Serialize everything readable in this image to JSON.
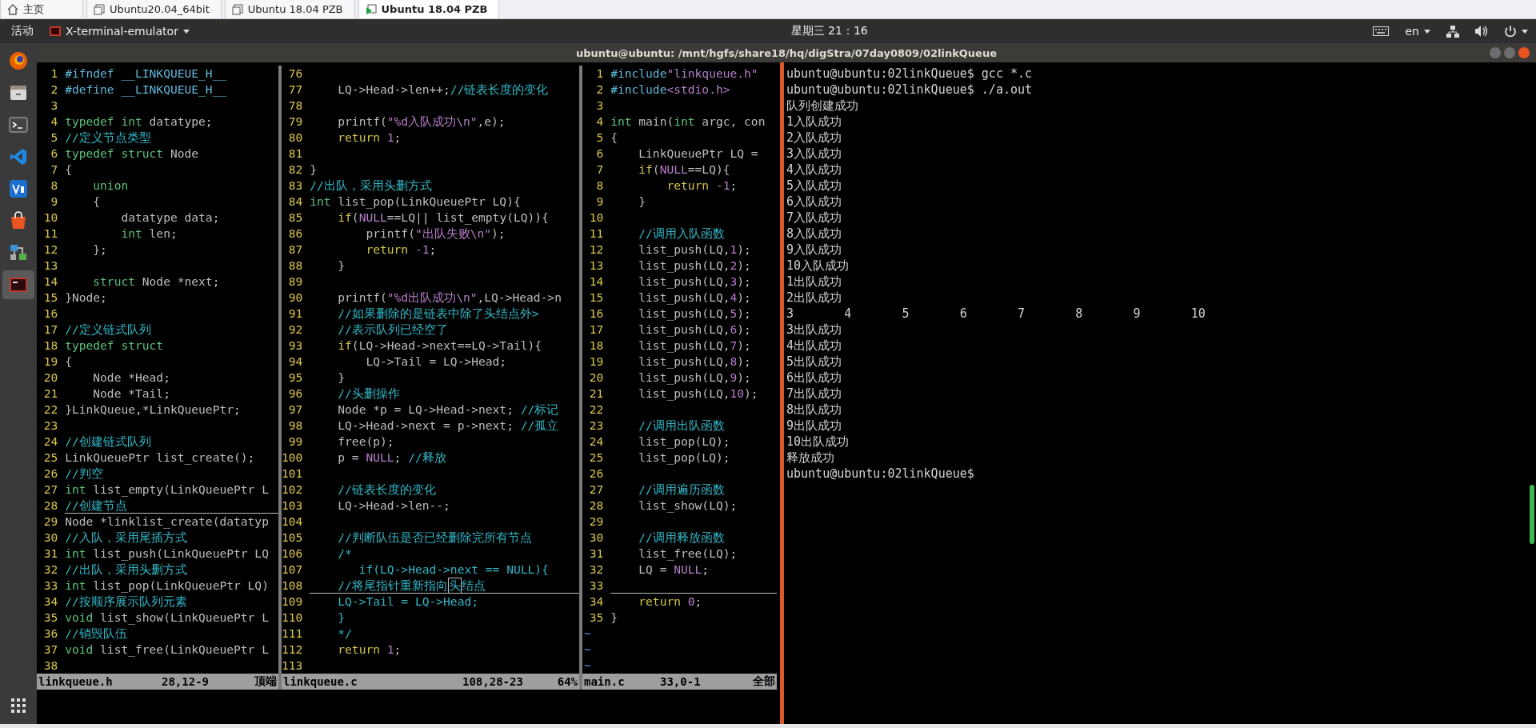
{
  "vm_tabs": [
    {
      "label": "主页",
      "kind": "home",
      "selected": false
    },
    {
      "label": "Ubuntu20.04_64bit",
      "kind": "vm",
      "selected": false
    },
    {
      "label": "Ubuntu 18.04 PZB",
      "kind": "vm",
      "selected": false
    },
    {
      "label": "Ubuntu 18.04 PZB",
      "kind": "vm",
      "selected": true
    }
  ],
  "top_bar": {
    "activities": "活动",
    "app_menu": "X-terminal-emulator",
    "clock": "星期三 21：16",
    "language": "en"
  },
  "window": {
    "title": "ubuntu@ubuntu: /mnt/hgfs/share18/hq/digStra/07day0809/02linkQueue"
  },
  "dock": {
    "items": [
      {
        "kind": "browser",
        "selected": false
      },
      {
        "kind": "files",
        "selected": false
      },
      {
        "kind": "terminal",
        "selected": false
      },
      {
        "kind": "editor",
        "selected": false
      },
      {
        "kind": "app",
        "selected": false
      },
      {
        "kind": "store",
        "selected": false
      },
      {
        "kind": "network",
        "selected": false
      },
      {
        "kind": "xterm",
        "selected": true
      }
    ]
  },
  "vim": {
    "panes": [
      {
        "file": "linkqueue.h",
        "position": "28,12-9",
        "scroll": "顶端",
        "lines": [
          {
            "num": "1",
            "current": false,
            "segs": [
              {
                "kind": "pre",
                "text": "#ifndef __LINKQUEUE_H__"
              }
            ]
          },
          {
            "num": "2",
            "current": false,
            "segs": [
              {
                "kind": "pre",
                "text": "#define __LINKQUEUE_H__"
              }
            ]
          },
          {
            "num": "3",
            "current": false
          },
          {
            "num": "4",
            "current": false,
            "segs": [
              {
                "kind": "type",
                "text": "typedef int"
              },
              {
                "kind": "plain",
                "text": " datatype;"
              }
            ]
          },
          {
            "num": "5",
            "current": false,
            "segs": [
              {
                "kind": "comment",
                "text": "//定义节点类型"
              }
            ]
          },
          {
            "num": "6",
            "current": false,
            "segs": [
              {
                "kind": "type",
                "text": "typedef struct"
              },
              {
                "kind": "plain",
                "text": " Node"
              }
            ]
          },
          {
            "num": "7",
            "current": false,
            "segs": [
              {
                "kind": "plain",
                "text": "{"
              }
            ]
          },
          {
            "num": "8",
            "current": false,
            "segs": [
              {
                "kind": "type",
                "text": "    union"
              }
            ]
          },
          {
            "num": "9",
            "current": false,
            "segs": [
              {
                "kind": "plain",
                "text": "    {"
              }
            ]
          },
          {
            "num": "10",
            "current": false,
            "segs": [
              {
                "kind": "plain",
                "text": "        datatype data;"
              }
            ]
          },
          {
            "num": "11",
            "current": false,
            "segs": [
              {
                "kind": "type",
                "text": "        int"
              },
              {
                "kind": "plain",
                "text": " len;"
              }
            ]
          },
          {
            "num": "12",
            "current": false,
            "segs": [
              {
                "kind": "plain",
                "text": "    };"
              }
            ]
          },
          {
            "num": "13",
            "current": false
          },
          {
            "num": "14",
            "current": false,
            "segs": [
              {
                "kind": "type",
                "text": "    struct"
              },
              {
                "kind": "plain",
                "text": " Node *next;"
              }
            ]
          },
          {
            "num": "15",
            "current": false,
            "segs": [
              {
                "kind": "plain",
                "text": "}Node;"
              }
            ]
          },
          {
            "num": "16",
            "current": false
          },
          {
            "num": "17",
            "current": false,
            "segs": [
              {
                "kind": "comment",
                "text": "//定义链式队列"
              }
            ]
          },
          {
            "num": "18",
            "current": false,
            "segs": [
              {
                "kind": "type",
                "text": "typedef struct"
              }
            ]
          },
          {
            "num": "19",
            "current": false,
            "segs": [
              {
                "kind": "plain",
                "text": "{"
              }
            ]
          },
          {
            "num": "20",
            "current": false,
            "segs": [
              {
                "kind": "plain",
                "text": "    Node *Head;"
              }
            ]
          },
          {
            "num": "21",
            "current": false,
            "segs": [
              {
                "kind": "plain",
                "text": "    Node *Tail;"
              }
            ]
          },
          {
            "num": "22",
            "current": false,
            "segs": [
              {
                "kind": "plain",
                "text": "}LinkQueue,*LinkQueuePtr;"
              }
            ]
          },
          {
            "num": "23",
            "current": false
          },
          {
            "num": "24",
            "current": false,
            "segs": [
              {
                "kind": "comment",
                "text": "//创建链式队列"
              }
            ]
          },
          {
            "num": "25",
            "current": false,
            "segs": [
              {
                "kind": "plain",
                "text": "LinkQueuePtr list_create();"
              }
            ]
          },
          {
            "num": "26",
            "current": false,
            "segs": [
              {
                "kind": "comment",
                "text": "//判空"
              }
            ]
          },
          {
            "num": "27",
            "current": false,
            "segs": [
              {
                "kind": "type",
                "text": "int"
              },
              {
                "kind": "plain",
                "text": " list_empty(LinkQueuePtr L"
              }
            ]
          },
          {
            "num": "28",
            "current": true,
            "segs": [
              {
                "kind": "comment",
                "text": "//创建节点"
              }
            ]
          },
          {
            "num": "29",
            "current": false,
            "segs": [
              {
                "kind": "plain",
                "text": "Node *linklist_create(datatyp"
              }
            ]
          },
          {
            "num": "30",
            "current": false,
            "segs": [
              {
                "kind": "comment",
                "text": "//入队，采用尾插方式"
              }
            ]
          },
          {
            "num": "31",
            "current": false,
            "segs": [
              {
                "kind": "type",
                "text": "int"
              },
              {
                "kind": "plain",
                "text": " list_push(LinkQueuePtr LQ"
              }
            ]
          },
          {
            "num": "32",
            "current": false,
            "segs": [
              {
                "kind": "comment",
                "text": "//出队，采用头删方式"
              }
            ]
          },
          {
            "num": "33",
            "current": false,
            "segs": [
              {
                "kind": "type",
                "text": "int"
              },
              {
                "kind": "plain",
                "text": " list_pop(LinkQueuePtr LQ)"
              }
            ]
          },
          {
            "num": "34",
            "current": false,
            "segs": [
              {
                "kind": "comment",
                "text": "//按顺序展示队列元素"
              }
            ]
          },
          {
            "num": "35",
            "current": false,
            "segs": [
              {
                "kind": "type",
                "text": "void"
              },
              {
                "kind": "plain",
                "text": " list_show(LinkQueuePtr L"
              }
            ]
          },
          {
            "num": "36",
            "current": false,
            "segs": [
              {
                "kind": "comment",
                "text": "//销毁队伍"
              }
            ]
          },
          {
            "num": "37",
            "current": false,
            "segs": [
              {
                "kind": "type",
                "text": "void"
              },
              {
                "kind": "plain",
                "text": " list_free(LinkQueuePtr L"
              }
            ]
          },
          {
            "num": "38",
            "current": false
          }
        ]
      },
      {
        "file": "linkqueue.c",
        "position": "108,28-23",
        "scroll": "64%",
        "lines": [
          {
            "num": "76",
            "current": false
          },
          {
            "num": "77",
            "current": false,
            "segs": [
              {
                "kind": "plain",
                "text": "    LQ->Head->len++;"
              },
              {
                "kind": "comment",
                "text": "//链表长度的变化"
              }
            ]
          },
          {
            "num": "78",
            "current": false
          },
          {
            "num": "79",
            "current": false,
            "segs": [
              {
                "kind": "plain",
                "text": "    printf("
              },
              {
                "kind": "const",
                "text": "\"%d入队成功\\n\""
              },
              {
                "kind": "plain",
                "text": ",e);"
              }
            ]
          },
          {
            "num": "80",
            "current": false,
            "segs": [
              {
                "kind": "stmt",
                "text": "    return "
              },
              {
                "kind": "const",
                "text": "1"
              },
              {
                "kind": "plain",
                "text": ";"
              }
            ]
          },
          {
            "num": "81",
            "current": false
          },
          {
            "num": "82",
            "current": false,
            "segs": [
              {
                "kind": "plain",
                "text": "}"
              }
            ]
          },
          {
            "num": "83",
            "current": false,
            "segs": [
              {
                "kind": "comment",
                "text": "//出队，采用头删方式"
              }
            ]
          },
          {
            "num": "84",
            "current": false,
            "segs": [
              {
                "kind": "type",
                "text": "int"
              },
              {
                "kind": "plain",
                "text": " list_pop(LinkQueuePtr LQ){"
              }
            ]
          },
          {
            "num": "85",
            "current": false,
            "segs": [
              {
                "kind": "stmt",
                "text": "    if"
              },
              {
                "kind": "plain",
                "text": "("
              },
              {
                "kind": "const",
                "text": "NULL"
              },
              {
                "kind": "plain",
                "text": "==LQ|| list_empty(LQ)){"
              }
            ]
          },
          {
            "num": "86",
            "current": false,
            "segs": [
              {
                "kind": "plain",
                "text": "        printf("
              },
              {
                "kind": "const",
                "text": "\"出队失败\\n\""
              },
              {
                "kind": "plain",
                "text": ");"
              }
            ]
          },
          {
            "num": "87",
            "current": false,
            "segs": [
              {
                "kind": "stmt",
                "text": "        return "
              },
              {
                "kind": "const",
                "text": "-1"
              },
              {
                "kind": "plain",
                "text": ";"
              }
            ]
          },
          {
            "num": "88",
            "current": false,
            "segs": [
              {
                "kind": "plain",
                "text": "    }"
              }
            ]
          },
          {
            "num": "89",
            "current": false
          },
          {
            "num": "90",
            "current": false,
            "segs": [
              {
                "kind": "plain",
                "text": "    printf("
              },
              {
                "kind": "const",
                "text": "\"%d出队成功\\n\""
              },
              {
                "kind": "plain",
                "text": ",LQ->Head->n"
              }
            ]
          },
          {
            "num": "91",
            "current": false,
            "segs": [
              {
                "kind": "comment",
                "text": "    //如果删除的是链表中除了头结点外>"
              }
            ]
          },
          {
            "num": "92",
            "current": false,
            "segs": [
              {
                "kind": "comment",
                "text": "    //表示队列已经空了"
              }
            ]
          },
          {
            "num": "93",
            "current": false,
            "segs": [
              {
                "kind": "stmt",
                "text": "    if"
              },
              {
                "kind": "plain",
                "text": "(LQ->Head->next==LQ->Tail){"
              }
            ]
          },
          {
            "num": "94",
            "current": false,
            "segs": [
              {
                "kind": "plain",
                "text": "        LQ->Tail = LQ->Head;"
              }
            ]
          },
          {
            "num": "95",
            "current": false,
            "segs": [
              {
                "kind": "plain",
                "text": "    }"
              }
            ]
          },
          {
            "num": "96",
            "current": false,
            "segs": [
              {
                "kind": "comment",
                "text": "    //头删操作"
              }
            ]
          },
          {
            "num": "97",
            "current": false,
            "segs": [
              {
                "kind": "plain",
                "text": "    Node *p = LQ->Head->next; "
              },
              {
                "kind": "comment",
                "text": "//标记"
              }
            ]
          },
          {
            "num": "98",
            "current": false,
            "segs": [
              {
                "kind": "plain",
                "text": "    LQ->Head->next = p->next; "
              },
              {
                "kind": "comment",
                "text": "//孤立"
              }
            ]
          },
          {
            "num": "99",
            "current": false,
            "segs": [
              {
                "kind": "plain",
                "text": "    free(p);"
              }
            ]
          },
          {
            "num": "100",
            "current": false,
            "segs": [
              {
                "kind": "plain",
                "text": "    p = "
              },
              {
                "kind": "const",
                "text": "NULL"
              },
              {
                "kind": "plain",
                "text": "; "
              },
              {
                "kind": "comment",
                "text": "//释放"
              }
            ]
          },
          {
            "num": "101",
            "current": false
          },
          {
            "num": "102",
            "current": false,
            "segs": [
              {
                "kind": "comment",
                "text": "    //链表长度的变化"
              }
            ]
          },
          {
            "num": "103",
            "current": false,
            "segs": [
              {
                "kind": "plain",
                "text": "    LQ->Head->len--;"
              }
            ]
          },
          {
            "num": "104",
            "current": false
          },
          {
            "num": "105",
            "current": false,
            "segs": [
              {
                "kind": "comment",
                "text": "    //判断队伍是否已经删除完所有节点"
              }
            ]
          },
          {
            "num": "106",
            "current": false,
            "segs": [
              {
                "kind": "comment",
                "text": "    /*"
              }
            ]
          },
          {
            "num": "107",
            "current": false,
            "segs": [
              {
                "kind": "comment",
                "text": "       if(LQ->Head->next == NULL){"
              }
            ]
          },
          {
            "num": "108",
            "current": true,
            "segs": [
              {
                "kind": "comment",
                "text": "    //将尾指针重新指向"
              },
              {
                "kind": "cursor",
                "text": "头"
              },
              {
                "kind": "comment",
                "text": "结点"
              }
            ]
          },
          {
            "num": "109",
            "current": false,
            "segs": [
              {
                "kind": "comment",
                "text": "    LQ->Tail = LQ->Head;"
              }
            ]
          },
          {
            "num": "110",
            "current": false,
            "segs": [
              {
                "kind": "comment",
                "text": "    }"
              }
            ]
          },
          {
            "num": "111",
            "current": false,
            "segs": [
              {
                "kind": "comment",
                "text": "    */"
              }
            ]
          },
          {
            "num": "112",
            "current": false,
            "segs": [
              {
                "kind": "stmt",
                "text": "    return "
              },
              {
                "kind": "const",
                "text": "1"
              },
              {
                "kind": "plain",
                "text": ";"
              }
            ]
          },
          {
            "num": "113",
            "current": false
          }
        ]
      },
      {
        "file": "main.c",
        "position": "33,0-1",
        "scroll": "全部",
        "lines": [
          {
            "num": "1",
            "current": false,
            "segs": [
              {
                "kind": "pre",
                "text": "#include"
              },
              {
                "kind": "const",
                "text": "\"linkqueue.h\""
              }
            ]
          },
          {
            "num": "2",
            "current": false,
            "segs": [
              {
                "kind": "pre",
                "text": "#include"
              },
              {
                "kind": "const",
                "text": "<stdio.h>"
              }
            ]
          },
          {
            "num": "3",
            "current": false
          },
          {
            "num": "4",
            "current": false,
            "segs": [
              {
                "kind": "type",
                "text": "int"
              },
              {
                "kind": "plain",
                "text": " main("
              },
              {
                "kind": "type",
                "text": "int"
              },
              {
                "kind": "plain",
                "text": " argc, con"
              }
            ]
          },
          {
            "num": "5",
            "current": false,
            "segs": [
              {
                "kind": "plain",
                "text": "{"
              }
            ]
          },
          {
            "num": "6",
            "current": false,
            "segs": [
              {
                "kind": "plain",
                "text": "    LinkQueuePtr LQ ="
              }
            ]
          },
          {
            "num": "7",
            "current": false,
            "segs": [
              {
                "kind": "stmt",
                "text": "    if"
              },
              {
                "kind": "plain",
                "text": "("
              },
              {
                "kind": "const",
                "text": "NULL"
              },
              {
                "kind": "plain",
                "text": "==LQ){"
              }
            ]
          },
          {
            "num": "8",
            "current": false,
            "segs": [
              {
                "kind": "stmt",
                "text": "        return "
              },
              {
                "kind": "const",
                "text": "-1"
              },
              {
                "kind": "plain",
                "text": ";"
              }
            ]
          },
          {
            "num": "9",
            "current": false,
            "segs": [
              {
                "kind": "plain",
                "text": "    }"
              }
            ]
          },
          {
            "num": "10",
            "current": false
          },
          {
            "num": "11",
            "current": false,
            "segs": [
              {
                "kind": "comment",
                "text": "    //调用入队函数"
              }
            ]
          },
          {
            "num": "12",
            "current": false,
            "segs": [
              {
                "kind": "plain",
                "text": "    list_push(LQ,"
              },
              {
                "kind": "const",
                "text": "1"
              },
              {
                "kind": "plain",
                "text": ");"
              }
            ]
          },
          {
            "num": "13",
            "current": false,
            "segs": [
              {
                "kind": "plain",
                "text": "    list_push(LQ,"
              },
              {
                "kind": "const",
                "text": "2"
              },
              {
                "kind": "plain",
                "text": ");"
              }
            ]
          },
          {
            "num": "14",
            "current": false,
            "segs": [
              {
                "kind": "plain",
                "text": "    list_push(LQ,"
              },
              {
                "kind": "const",
                "text": "3"
              },
              {
                "kind": "plain",
                "text": ");"
              }
            ]
          },
          {
            "num": "15",
            "current": false,
            "segs": [
              {
                "kind": "plain",
                "text": "    list_push(LQ,"
              },
              {
                "kind": "const",
                "text": "4"
              },
              {
                "kind": "plain",
                "text": ");"
              }
            ]
          },
          {
            "num": "16",
            "current": false,
            "segs": [
              {
                "kind": "plain",
                "text": "    list_push(LQ,"
              },
              {
                "kind": "const",
                "text": "5"
              },
              {
                "kind": "plain",
                "text": ");"
              }
            ]
          },
          {
            "num": "17",
            "current": false,
            "segs": [
              {
                "kind": "plain",
                "text": "    list_push(LQ,"
              },
              {
                "kind": "const",
                "text": "6"
              },
              {
                "kind": "plain",
                "text": ");"
              }
            ]
          },
          {
            "num": "18",
            "current": false,
            "segs": [
              {
                "kind": "plain",
                "text": "    list_push(LQ,"
              },
              {
                "kind": "const",
                "text": "7"
              },
              {
                "kind": "plain",
                "text": ");"
              }
            ]
          },
          {
            "num": "19",
            "current": false,
            "segs": [
              {
                "kind": "plain",
                "text": "    list_push(LQ,"
              },
              {
                "kind": "const",
                "text": "8"
              },
              {
                "kind": "plain",
                "text": ");"
              }
            ]
          },
          {
            "num": "20",
            "current": false,
            "segs": [
              {
                "kind": "plain",
                "text": "    list_push(LQ,"
              },
              {
                "kind": "const",
                "text": "9"
              },
              {
                "kind": "plain",
                "text": ");"
              }
            ]
          },
          {
            "num": "21",
            "current": false,
            "segs": [
              {
                "kind": "plain",
                "text": "    list_push(LQ,"
              },
              {
                "kind": "const",
                "text": "10"
              },
              {
                "kind": "plain",
                "text": ");"
              }
            ]
          },
          {
            "num": "22",
            "current": false
          },
          {
            "num": "23",
            "current": false,
            "segs": [
              {
                "kind": "comment",
                "text": "    //调用出队函数"
              }
            ]
          },
          {
            "num": "24",
            "current": false,
            "segs": [
              {
                "kind": "plain",
                "text": "    list_pop(LQ);"
              }
            ]
          },
          {
            "num": "25",
            "current": false,
            "segs": [
              {
                "kind": "plain",
                "text": "    list_pop(LQ);"
              }
            ]
          },
          {
            "num": "26",
            "current": false
          },
          {
            "num": "27",
            "current": false,
            "segs": [
              {
                "kind": "comment",
                "text": "    //调用遍历函数"
              }
            ]
          },
          {
            "num": "28",
            "current": false,
            "segs": [
              {
                "kind": "plain",
                "text": "    list_show(LQ);"
              }
            ]
          },
          {
            "num": "29",
            "current": false
          },
          {
            "num": "30",
            "current": false,
            "segs": [
              {
                "kind": "comment",
                "text": "    //调用释放函数"
              }
            ]
          },
          {
            "num": "31",
            "current": false,
            "segs": [
              {
                "kind": "plain",
                "text": "    list_free(LQ);"
              }
            ]
          },
          {
            "num": "32",
            "current": false,
            "segs": [
              {
                "kind": "plain",
                "text": "    LQ = "
              },
              {
                "kind": "const",
                "text": "NULL"
              },
              {
                "kind": "plain",
                "text": ";"
              }
            ]
          },
          {
            "num": "33",
            "current": true
          },
          {
            "num": "34",
            "current": false,
            "segs": [
              {
                "kind": "stmt",
                "text": "    return "
              },
              {
                "kind": "const",
                "text": "0"
              },
              {
                "kind": "plain",
                "text": ";"
              }
            ]
          },
          {
            "num": "35",
            "current": false,
            "segs": [
              {
                "kind": "plain",
                "text": "}"
              }
            ]
          }
        ],
        "filler": [
          "~",
          "~",
          "~"
        ]
      }
    ]
  },
  "terminal": {
    "lines": [
      "ubuntu@ubuntu:02linkQueue$ gcc *.c",
      "ubuntu@ubuntu:02linkQueue$ ./a.out",
      "队列创建成功",
      "1入队成功",
      "2入队成功",
      "3入队成功",
      "4入队成功",
      "5入队成功",
      "6入队成功",
      "7入队成功",
      "8入队成功",
      "9入队成功",
      "10入队成功",
      "1出队成功",
      "2出队成功",
      "3\t4\t5\t6\t7\t8\t9\t10",
      "3出队成功",
      "4出队成功",
      "5出队成功",
      "6出队成功",
      "7出队成功",
      "8出队成功",
      "9出队成功",
      "10出队成功",
      "释放成功",
      "ubuntu@ubuntu:02linkQueue$"
    ]
  }
}
